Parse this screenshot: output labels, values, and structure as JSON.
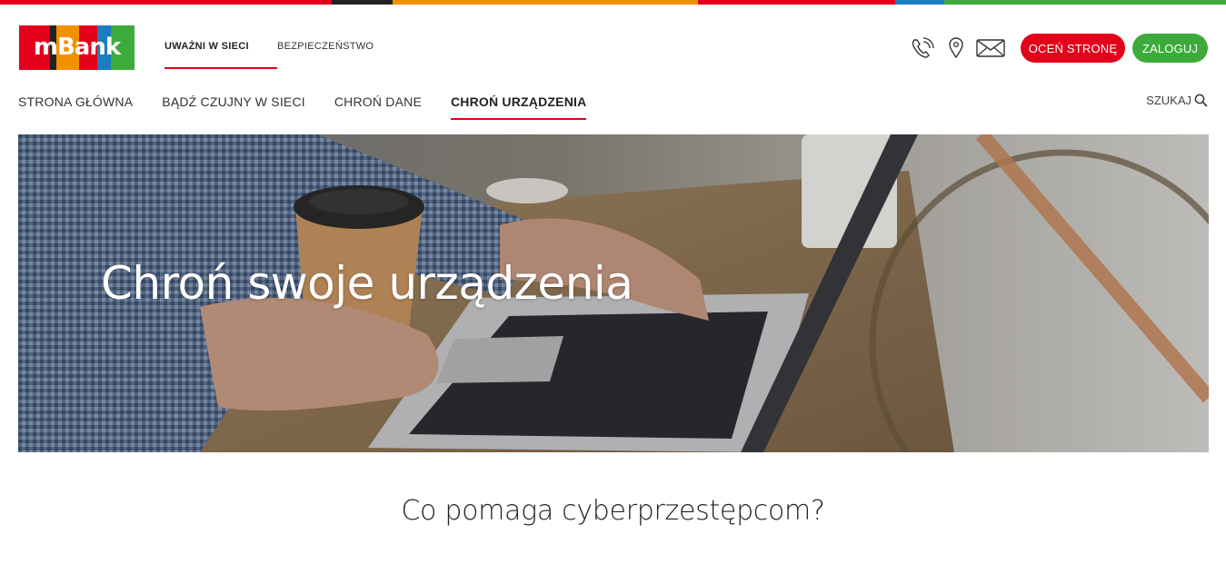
{
  "brand": {
    "logo_text": "mBank",
    "strip_colors": [
      "#e3001b",
      "#222222",
      "#f29100",
      "#e3001b",
      "#1b7cc1",
      "#3cab3b"
    ],
    "logo_colors": [
      "#e3001b",
      "#222222",
      "#f29100",
      "#e3001b",
      "#1b7cc1",
      "#3cab3b"
    ]
  },
  "top_nav": {
    "items": [
      {
        "label": "UWAŻNI W SIECI",
        "active": true
      },
      {
        "label": "BEZPIECZEŃSTWO",
        "active": false
      }
    ]
  },
  "header_icons": [
    "phone-icon",
    "location-pin-icon",
    "mail-icon"
  ],
  "buttons": {
    "rate": {
      "label": "OCEŃ STRONĘ",
      "color": "#e3001b"
    },
    "login": {
      "label": "ZALOGUJ",
      "color": "#3cab3b"
    }
  },
  "main_nav": {
    "items": [
      {
        "label": "STRONA GŁÓWNA",
        "active": false
      },
      {
        "label": "BĄDŹ CZUJNY W SIECI",
        "active": false
      },
      {
        "label": "CHROŃ DANE",
        "active": false
      },
      {
        "label": "CHROŃ URZĄDZENIA",
        "active": true
      }
    ],
    "search_label": "SZUKAJ"
  },
  "hero": {
    "title": "Chroń swoje urządzenia"
  },
  "section": {
    "title": "Co pomaga cyberprzestępcom?"
  }
}
